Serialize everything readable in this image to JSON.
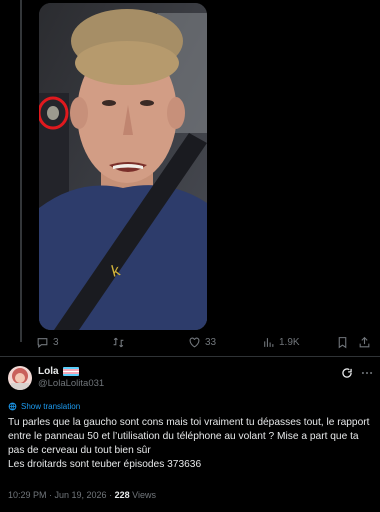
{
  "quoted_post": {
    "actions": {
      "replies": "3",
      "reposts": "",
      "likes": "33",
      "views": "1.9K"
    }
  },
  "tweet": {
    "display_name": "Lola",
    "handle": "@LolaLolita031",
    "translate_label": "Show translation",
    "text_lines": [
      "Tu parles que la gaucho sont cons mais toi vraiment tu dépasses tout, le rapport entre le panneau 50 et l’utilisation du téléphone au volant ? Mise a part que ta pas de cerveau du tout bien sûr",
      "Les droitards sont teuber épisodes 373636"
    ],
    "time": "10:29 PM · Jun 19, 2026 · ",
    "views_count": "228",
    "views_label": " Views"
  },
  "colors": {
    "background": "#000000",
    "text": "#e7e9ea",
    "muted": "#71767b",
    "accent": "#1d9bf0",
    "annotation_circle": "#e0191e"
  },
  "icons": [
    "reply-icon",
    "repost-icon",
    "like-icon",
    "views-icon",
    "bookmark-icon",
    "share-icon",
    "grok-icon",
    "more-icon",
    "translate-icon",
    "trans-flag-icon"
  ]
}
